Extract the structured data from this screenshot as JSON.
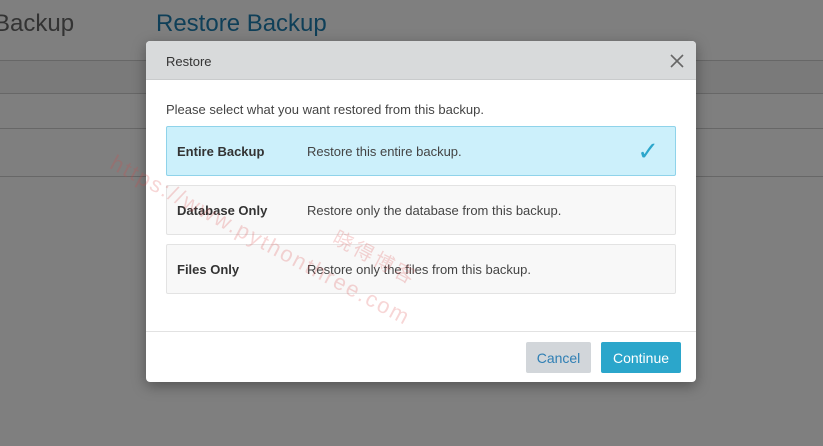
{
  "background": {
    "left_heading": "Backup",
    "main_heading": "Restore Backup"
  },
  "watermark": {
    "url_text": "https://www.pythonthree.com",
    "cn_text": "晓得博客"
  },
  "dialog": {
    "title": "Restore",
    "close_icon": "close-icon",
    "prompt": "Please select what you want restored from this backup.",
    "options": [
      {
        "name": "Entire Backup",
        "description": "Restore this entire backup.",
        "selected": true
      },
      {
        "name": "Database Only",
        "description": "Restore only the database from this backup.",
        "selected": false
      },
      {
        "name": "Files Only",
        "description": "Restore only the files from this backup.",
        "selected": false
      }
    ],
    "check_glyph": "✓",
    "cancel_label": "Cancel",
    "continue_label": "Continue"
  },
  "colors": {
    "accent": "#2ba6cb",
    "selected_bg": "#ccf0fb",
    "header_bg": "#d8dadb"
  }
}
